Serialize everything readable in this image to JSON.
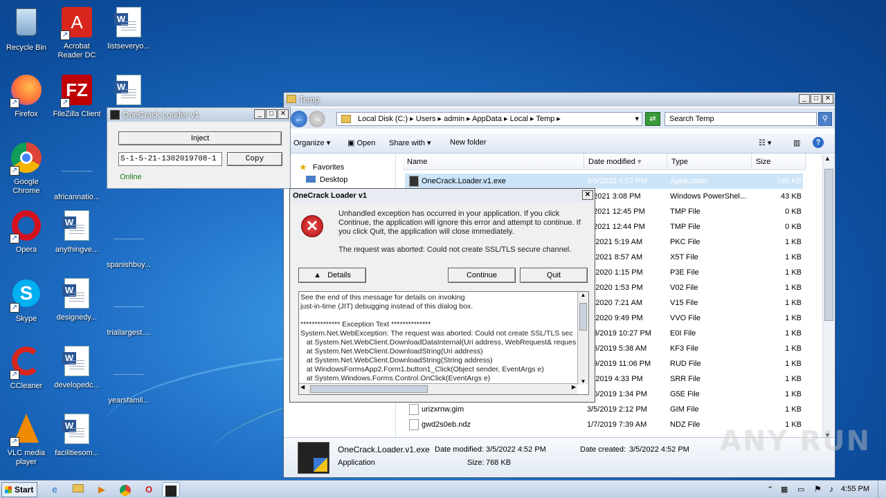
{
  "desktop": {
    "icons": [
      {
        "label": "Recycle Bin"
      },
      {
        "label": "Acrobat Reader DC"
      },
      {
        "label": "listseveryo..."
      },
      {
        "label": "Firefox"
      },
      {
        "label": "FileZilla Client"
      },
      {
        "label": "Google Chrome"
      },
      {
        "label": "africannatio..."
      },
      {
        "label": "Opera"
      },
      {
        "label": "anythingve..."
      },
      {
        "label": "spanishbuy..."
      },
      {
        "label": "Skype"
      },
      {
        "label": "designedy..."
      },
      {
        "label": "triallargest...."
      },
      {
        "label": "CCleaner"
      },
      {
        "label": "developedc..."
      },
      {
        "label": "yearsfamil..."
      },
      {
        "label": "VLC media player"
      },
      {
        "label": "facilitiesom..."
      }
    ]
  },
  "loader": {
    "title": "OneCrack Loader v1",
    "inject_label": "Inject",
    "sid_value": "S-1-5-21-1302019708-1",
    "copy_label": "Copy",
    "status": "Online",
    "status_color": "#1a7a1a"
  },
  "explorer": {
    "title": "Temp",
    "breadcrumb": [
      "Local Disk (C:)",
      "Users",
      "admin",
      "AppData",
      "Local",
      "Temp"
    ],
    "search_placeholder": "Search Temp",
    "toolbar": {
      "organize": "Organize",
      "open": "Open",
      "share_with": "Share with",
      "new_folder": "New folder"
    },
    "nav": {
      "favorites": "Favorites",
      "desktop": "Desktop"
    },
    "columns": {
      "name": "Name",
      "date": "Date modified",
      "type": "Type",
      "size": "Size"
    },
    "rows": [
      {
        "name": "OneCrack.Loader.v1.exe",
        "date": "3/5/2022 4:52 PM",
        "type": "Application",
        "size": "769 KB"
      },
      {
        "name": "",
        "date": "1/2021 3:08 PM",
        "type": "Windows PowerShel...",
        "size": "43 KB"
      },
      {
        "name": "",
        "date": "1/2021 12:45 PM",
        "type": "TMP File",
        "size": "0 KB"
      },
      {
        "name": "",
        "date": "1/2021 12:44 PM",
        "type": "TMP File",
        "size": "0 KB"
      },
      {
        "name": "",
        "date": "/7/2021 5:19 AM",
        "type": "PKC File",
        "size": "1 KB"
      },
      {
        "name": "",
        "date": "/4/2021 8:57 AM",
        "type": "X5T File",
        "size": "1 KB"
      },
      {
        "name": "",
        "date": "/9/2020 1:15 PM",
        "type": "P3E File",
        "size": "1 KB"
      },
      {
        "name": "",
        "date": "/5/2020 1:53 PM",
        "type": "V02 File",
        "size": "1 KB"
      },
      {
        "name": "",
        "date": "/9/2020 7:21 AM",
        "type": "V15 File",
        "size": "1 KB"
      },
      {
        "name": "",
        "date": "/7/2020 9:49 PM",
        "type": "VVO File",
        "size": "1 KB"
      },
      {
        "name": "",
        "date": "/23/2019 10:27 PM",
        "type": "E0I File",
        "size": "1 KB"
      },
      {
        "name": "",
        "date": "/26/2019 5:38 AM",
        "type": "KF3 File",
        "size": "1 KB"
      },
      {
        "name": "",
        "date": "/29/2019 11:06 PM",
        "type": "RUD File",
        "size": "1 KB"
      },
      {
        "name": "",
        "date": "/3/2019 4:33 PM",
        "type": "SRR File",
        "size": "1 KB"
      },
      {
        "name": "",
        "date": "/30/2019 1:34 PM",
        "type": "G5E File",
        "size": "1 KB"
      },
      {
        "name": "urizxrnw.gim",
        "date": "3/5/2019 2:12 PM",
        "type": "GIM File",
        "size": "1 KB"
      },
      {
        "name": "gwd2s0eb.ndz",
        "date": "1/7/2019 7:39 AM",
        "type": "NDZ File",
        "size": "1 KB"
      }
    ],
    "details": {
      "filename": "OneCrack.Loader.v1.exe",
      "modified_label": "Date modified:",
      "modified_value": "3/5/2022 4:52 PM",
      "created_label": "Date created:",
      "created_value": "3/5/2022 4:52 PM",
      "type": "Application",
      "size_label": "Size:",
      "size_value": "768 KB"
    }
  },
  "error_dialog": {
    "title": "OneCrack Loader v1",
    "message": "Unhandled exception has occurred in your application. If you click Continue, the application will ignore this error and attempt to continue. If you click Quit, the application will close immediately.",
    "detail_msg": "The request was aborted: Could not create SSL/TLS secure channel.",
    "details_label": "Details",
    "continue_label": "Continue",
    "quit_label": "Quit",
    "details_text": "See the end of this message for details on invoking\njust-in-time (JIT) debugging instead of this dialog box.\n\n************** Exception Text **************\nSystem.Net.WebException: The request was aborted: Could not create SSL/TLS sec\n   at System.Net.WebClient.DownloadDataInternal(Uri address, WebRequest& reques\n   at System.Net.WebClient.DownloadString(Uri address)\n   at System.Net.WebClient.DownloadString(String address)\n   at WindowsFormsApp2.Form1.button1_Click(Object sender, EventArgs e)\n   at System.Windows.Forms.Control.OnClick(EventArgs e)"
  },
  "taskbar": {
    "start_label": "Start",
    "clock": "4:55 PM"
  },
  "watermark": "ANY RUN"
}
